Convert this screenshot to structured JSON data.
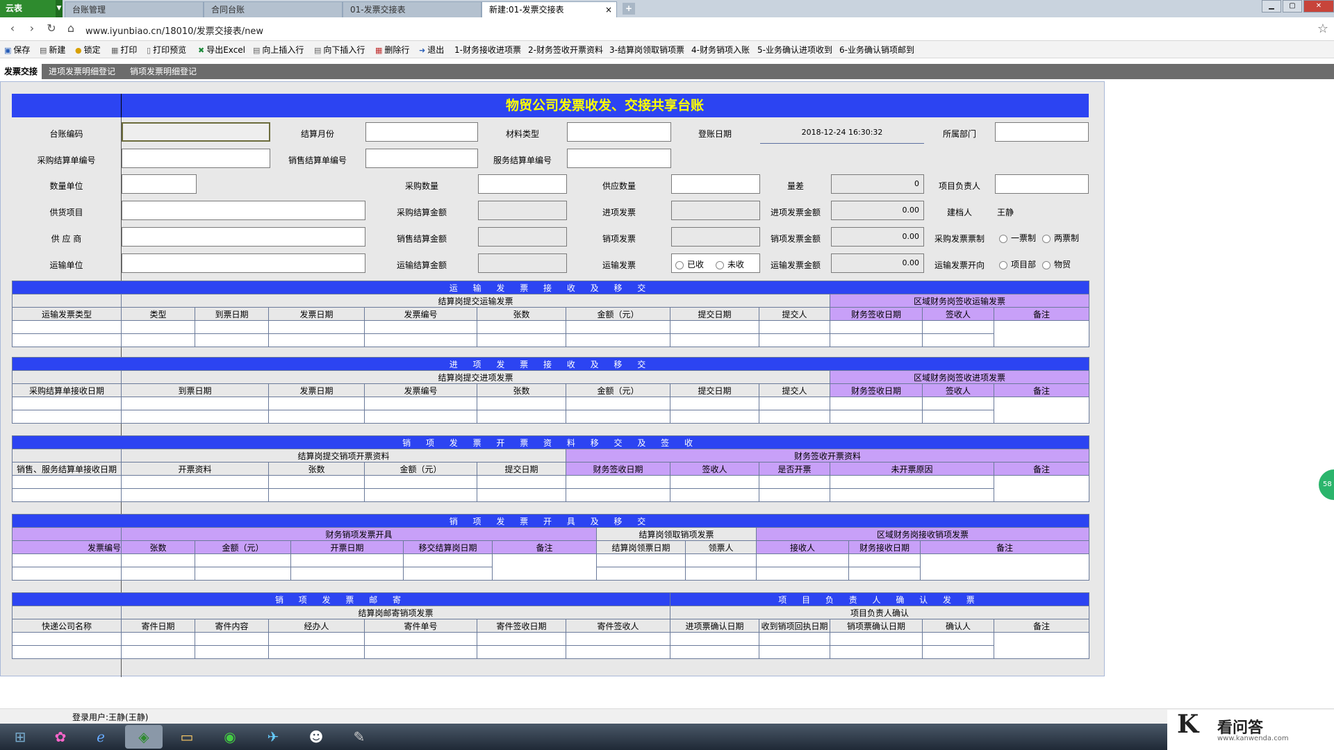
{
  "browser": {
    "app_name": "云表",
    "tabs": [
      "台账管理",
      "合同台账",
      "01-发票交接表",
      "新建:01-发票交接表"
    ],
    "close_glyph": "×",
    "new_tab_glyph": "+",
    "url": "www.iyunbiao.cn/18010/发票交接表/new"
  },
  "toolbar": {
    "items": [
      "保存",
      "新建",
      "锁定",
      "打印",
      "打印预览",
      "导出Excel",
      "向上插入行",
      "向下插入行",
      "删除行",
      "退出",
      "1-财务接收进项票",
      "2-财务签收开票资料",
      "3-结算岗领取销项票",
      "4-财务销项入账",
      "5-业务确认进项收到",
      "6-业务确认销项邮到"
    ]
  },
  "subtabs": [
    "发票交接",
    "进项发票明细登记",
    "销项发票明细登记"
  ],
  "form": {
    "title": "物贸公司发票收发、交接共享台账",
    "labels": {
      "ledger_code": "台账编码",
      "settle_month": "结算月份",
      "material_type": "材料类型",
      "register_date": "登账日期",
      "department": "所属部门",
      "purchase_no": "采购结算单编号",
      "sales_no": "销售结算单编号",
      "service_no": "服务结算单编号",
      "unit": "数量单位",
      "purchase_qty": "采购数量",
      "supply_qty": "供应数量",
      "qty_diff": "量差",
      "project_lead": "项目负责人",
      "supply_item": "供货项目",
      "purchase_amount": "采购结算金额",
      "input_invoice": "进项发票",
      "input_invoice_amount": "进项发票金额",
      "creator": "建档人",
      "supplier": "供 应 商",
      "sales_amount": "销售结算金额",
      "output_invoice": "销项发票",
      "output_invoice_amount": "销项发票金额",
      "purchase_ticket_system": "采购发票票制",
      "transport_unit": "运输单位",
      "transport_amount": "运输结算金额",
      "transport_invoice": "运输发票",
      "transport_invoice_amount": "运输发票金额",
      "transport_invoice_direction": "运输发票开向"
    },
    "values": {
      "register_date": "2018-12-24 16:30:32",
      "qty_diff": "0",
      "input_invoice_amount": "0.00",
      "output_invoice_amount": "0.00",
      "transport_invoice_amount": "0.00",
      "creator": "王静"
    },
    "radios": {
      "ticket_system": [
        "一票制",
        "两票制"
      ],
      "transport_invoice": [
        "已收",
        "未收"
      ],
      "direction": [
        "项目部",
        "物贸"
      ]
    }
  },
  "sections": {
    "s1": {
      "title": "运 输 发 票 接 收 及 移 交",
      "group_left": "结算岗提交运输发票",
      "group_right": "区域财务岗签收运输发票",
      "cols": [
        "运输发票类型",
        "类型",
        "到票日期",
        "发票日期",
        "发票编号",
        "张数",
        "金额（元）",
        "提交日期",
        "提交人",
        "财务签收日期",
        "签收人",
        "备注"
      ]
    },
    "s2": {
      "title": "进 项 发 票 接 收 及 移 交",
      "group_left": "结算岗提交进项发票",
      "group_right": "区域财务岗签收进项发票",
      "cols": [
        "采购结算单接收日期",
        "到票日期",
        "发票日期",
        "发票编号",
        "张数",
        "金额（元）",
        "提交日期",
        "提交人",
        "财务签收日期",
        "签收人",
        "备注"
      ]
    },
    "s3": {
      "title": "销 项 发 票 开 票 资 料 移 交 及 签 收",
      "group_left": "结算岗提交销项开票资料",
      "group_right": "财务签收开票资料",
      "cols": [
        "销售、服务结算单接收日期",
        "开票资料",
        "张数",
        "金额（元）",
        "提交日期",
        "财务签收日期",
        "签收人",
        "是否开票",
        "未开票原因",
        "备注"
      ]
    },
    "s4": {
      "title": "销 项 发 票 开 具 及 移 交",
      "group_left": "财务销项发票开具",
      "group_mid": "结算岗领取销项发票",
      "group_right": "区域财务岗接收销项发票",
      "cols": [
        "发票编号",
        "张数",
        "金额（元）",
        "开票日期",
        "移交结算岗日期",
        "备注",
        "结算岗领票日期",
        "领票人",
        "接收人",
        "财务接收日期",
        "备注"
      ]
    },
    "s5": {
      "title_left": "销 项 发 票 邮 寄",
      "title_right": "项 目 负 责 人 确 认 发 票",
      "group_left": "结算岗邮寄销项发票",
      "group_right": "项目负责人确认",
      "cols": [
        "快递公司名称",
        "寄件日期",
        "寄件内容",
        "经办人",
        "寄件单号",
        "寄件签收日期",
        "寄件签收人",
        "进项票确认日期",
        "收到销项回执日期",
        "销项票确认日期",
        "确认人",
        "备注"
      ]
    }
  },
  "status": {
    "user": "登录用户:王静(王静)"
  },
  "float_ball": "58",
  "watermark": {
    "title": "看问答",
    "url": "www.kanwenda.com"
  }
}
